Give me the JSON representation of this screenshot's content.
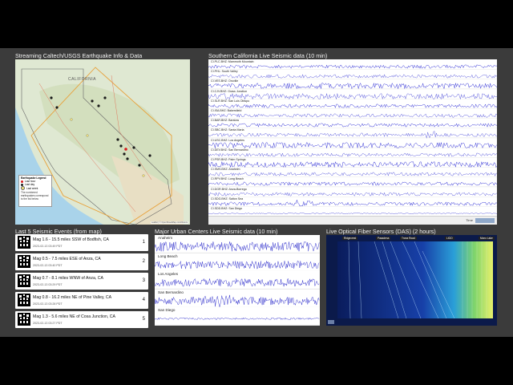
{
  "titles": {
    "map": "Streaming Caltech/USGS Earthquake Info & Data",
    "socal": "Southern California Live Seismic data (10 min)",
    "events": "Last 5 Seismic Events (from map)",
    "urban": "Major Urban Centers Live Seismic data (10 min)",
    "das": "Live Optical Fiber Sensors (DAS) (2 hours)"
  },
  "map": {
    "state_label": "CALIFORNIA",
    "legend": {
      "title": "Earthquake Legend",
      "items": [
        {
          "label": "Last hour",
          "color": "#d7191c"
        },
        {
          "label": "Last day",
          "color": "#1a1a1a"
        },
        {
          "label": "Last week",
          "color": "#f2e27a"
        }
      ],
      "note": "The numbered earthquakes correspond to the list below"
    },
    "attribution": "Leaflet | © OpenStreetMap contributors"
  },
  "socal": {
    "stations": [
      "CI.PLC.BHZ: Mammoth Mountain",
      "CI.PHL: South Valley",
      "CI.VES.BHZ: Oroville",
      "CI.CJV.BHZ: Grass Junction",
      "CI.SLR.BHZ: San Luis Obispo",
      "CI.ISA.BHZ: Bakersfield",
      "CI.BAR.BHZ: Barstow",
      "CI.SBC.BHZ: Santa Maria",
      "CI.USC.BHZ: Los Angeles",
      "CI.DEV.BHZ: San Bernardino",
      "CI.PSR.BHZ: Palm Springs",
      "CI.SMS.BHZ: Anaheim",
      "CI.RPV.BHZ: Long Beach",
      "CI.DGR.BHZ: Anza-Borrego",
      "CI.SDG.BHZ: Salton Sea",
      "CI.SDD.BHZ: San Diego"
    ],
    "footer_text": "Time"
  },
  "events": [
    {
      "title": "Mag 1.6 - 15.5 miles SSW of Bodfish, CA",
      "time": "2023-02-13 03:49 PDT",
      "num": "1"
    },
    {
      "title": "Mag 0.5 - 7.5 miles ESE of Anza, CA",
      "time": "2023-02-13 03:40 PDT",
      "num": "2"
    },
    {
      "title": "Mag 0.7 - 8.1 miles WNW of Anza, CA",
      "time": "2023-02-13 03:29 PDT",
      "num": "3"
    },
    {
      "title": "Mag 0.8 - 16.2 miles NE of Pine Valley, CA",
      "time": "2023-02-13 03:28 PDT",
      "num": "4"
    },
    {
      "title": "Mag 1.3 - 5.6 miles NE of Cosa Junction, CA",
      "time": "2023-02-13 03:27 PDT",
      "num": "5"
    }
  ],
  "urban": {
    "stations": [
      "Anaheim",
      "Long Beach",
      "Los Angeles",
      "San Bernardino",
      "San Diego"
    ]
  },
  "das": {
    "captions": [
      "Ridgecrest",
      "Pasadena",
      "Trona Road",
      "LIGO",
      "Mono Lake"
    ]
  }
}
